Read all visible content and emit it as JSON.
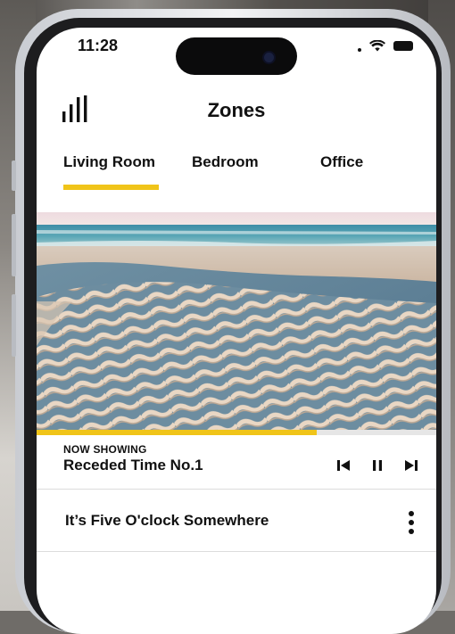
{
  "status_bar": {
    "time": "11:28"
  },
  "header": {
    "title": "Zones",
    "logo_icon": "sound-bars-icon"
  },
  "tabs": [
    {
      "label": "Living Room",
      "selected": true
    },
    {
      "label": "Bedroom",
      "selected": false
    },
    {
      "label": "Office",
      "selected": false
    }
  ],
  "colors": {
    "accent": "#f0c419",
    "text": "#111111",
    "divider": "#dcdcdc"
  },
  "now_showing": {
    "label": "NOW SHOWING",
    "title": "Receded Time No.1",
    "progress": 0.7,
    "controls": [
      "skip-back-icon",
      "pause-icon",
      "skip-forward-icon"
    ]
  },
  "playlist": [
    {
      "title": "It’s Five O'clock Somewhere",
      "menu_icon": "more-vertical-icon"
    }
  ]
}
